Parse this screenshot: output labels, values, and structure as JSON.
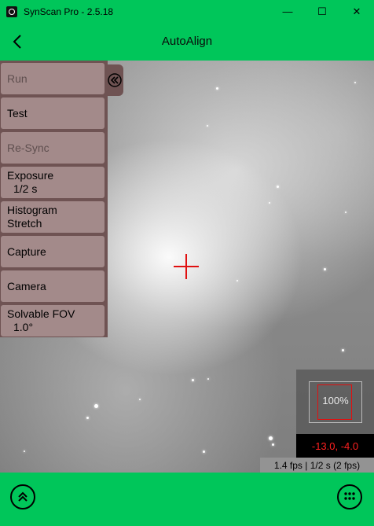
{
  "window": {
    "title": "SynScan Pro - 2.5.18",
    "minimize": "—",
    "maximize": "☐",
    "close": "✕"
  },
  "header": {
    "title": "AutoAlign",
    "back_icon": "chevron-left-icon"
  },
  "side_menu": {
    "items": [
      {
        "label": "Run",
        "value": "",
        "enabled": false
      },
      {
        "label": "Test",
        "value": "",
        "enabled": true
      },
      {
        "label": "Re-Sync",
        "value": "",
        "enabled": false
      },
      {
        "label": "Exposure",
        "value": "1/2 s",
        "enabled": true
      },
      {
        "label": "Histogram",
        "value": "Stretch",
        "enabled": true
      },
      {
        "label": "Capture",
        "value": "",
        "enabled": true
      },
      {
        "label": "Camera",
        "value": "",
        "enabled": true
      },
      {
        "label": "Solvable FOV",
        "value": "1.0°",
        "enabled": true
      }
    ],
    "collapse_icon": "double-chevron-left-icon"
  },
  "viewer": {
    "zoom_label": "100%",
    "coords": "-13.0,  -4.0",
    "fps": "1.4 fps | 1/2 s (2 fps)"
  },
  "bottom_bar": {
    "left_icon": "double-chevron-up-icon",
    "right_icon": "grid-menu-icon"
  },
  "colors": {
    "accent": "#00c65a",
    "menu_bg": "#6f5353",
    "menu_button": "#a38a8a",
    "crosshair": "#e01010"
  }
}
